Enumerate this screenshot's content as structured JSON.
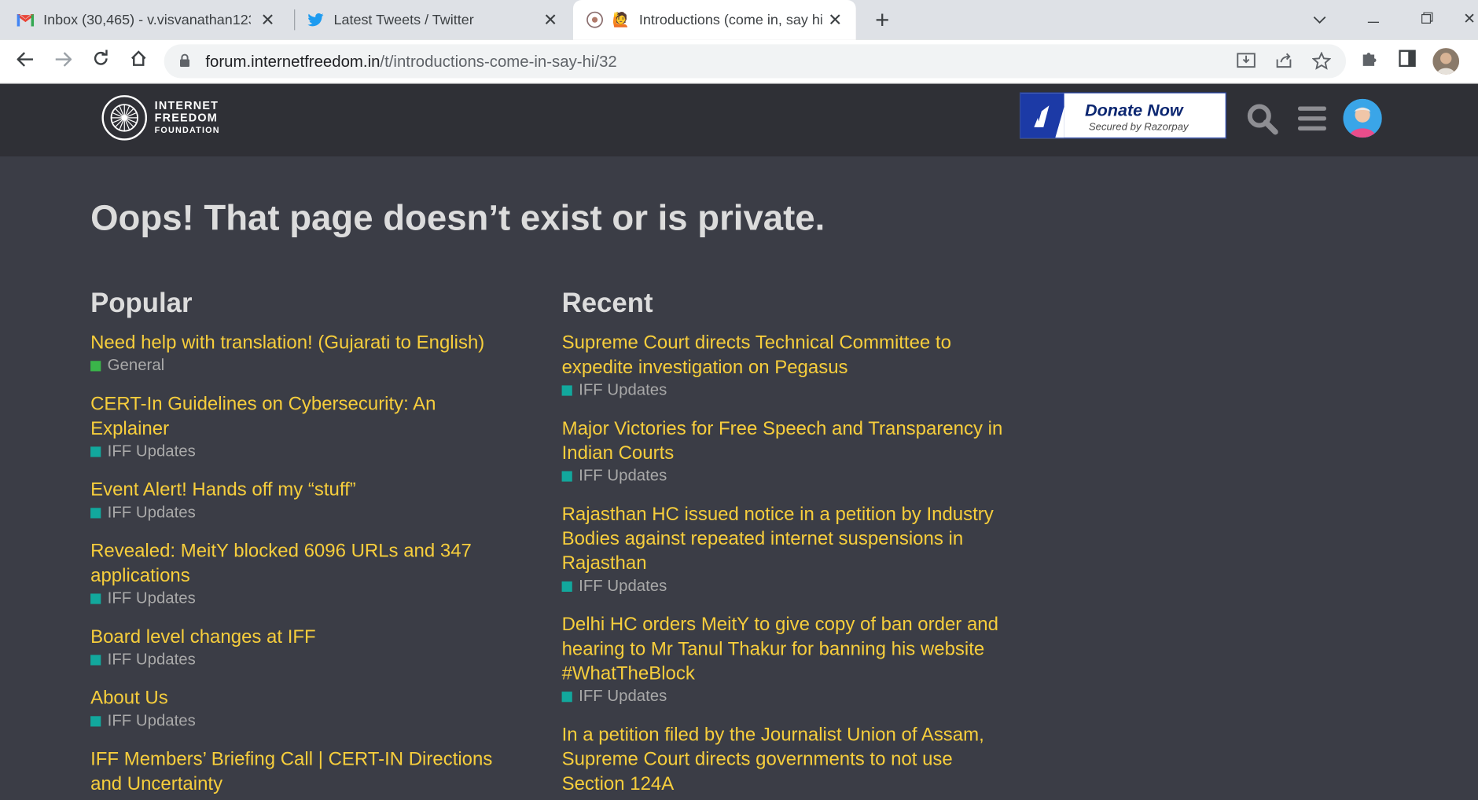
{
  "browser": {
    "tabs": [
      {
        "title": "Inbox (30,465) - v.visvanathan123",
        "icon": "gmail-icon",
        "active": false
      },
      {
        "title": "Latest Tweets / Twitter",
        "icon": "twitter-icon",
        "active": false
      },
      {
        "title": "Introductions (come in, say hi",
        "icon": "site-favicon",
        "active": true
      }
    ],
    "url_domain": "forum.internetfreedom.in",
    "url_path": "/t/introductions-come-in-say-hi/32"
  },
  "site": {
    "logo_line1": "INTERNET",
    "logo_line2": "FREEDOM",
    "logo_line3": "FOUNDATION",
    "donate_label": "Donate Now",
    "donate_sub": "Secured by Razorpay"
  },
  "page": {
    "title": "Oops! That page doesn’t exist or is private."
  },
  "popular": {
    "heading": "Popular",
    "topics": [
      {
        "title": "Need help with translation! (Gujarati to English)",
        "category": "General",
        "color": "#3ab54a"
      },
      {
        "title": "CERT-In Guidelines on Cybersecurity: An Explainer",
        "category": "IFF Updates",
        "color": "#12a89d"
      },
      {
        "title": "Event Alert! Hands off my “stuff”",
        "category": "IFF Updates",
        "color": "#12a89d"
      },
      {
        "title": "Revealed: MeitY blocked 6096 URLs and 347 applications",
        "category": "IFF Updates",
        "color": "#12a89d"
      },
      {
        "title": "Board level changes at IFF",
        "category": "IFF Updates",
        "color": "#12a89d"
      },
      {
        "title": "About Us",
        "category": "IFF Updates",
        "color": "#12a89d"
      },
      {
        "title": "IFF Members’ Briefing Call | CERT-IN Directions and Uncertainty",
        "category": "",
        "color": "#12a89d"
      }
    ]
  },
  "recent": {
    "heading": "Recent",
    "topics": [
      {
        "title": "Supreme Court directs Technical Committee to expedite investigation on Pegasus",
        "category": "IFF Updates",
        "color": "#12a89d"
      },
      {
        "title": "Major Victories for Free Speech and Transparency in Indian Courts",
        "category": "IFF Updates",
        "color": "#12a89d"
      },
      {
        "title": "Rajasthan HC issued notice in a petition by Industry Bodies against repeated internet suspensions in Rajasthan",
        "category": "IFF Updates",
        "color": "#12a89d"
      },
      {
        "title": "Delhi HC orders MeitY to give copy of ban order and hearing to Mr Tanul Thakur for banning his website #WhatTheBlock",
        "category": "IFF Updates",
        "color": "#12a89d"
      },
      {
        "title": "In a petition filed by the Journalist Union of Assam, Supreme Court directs governments to not use Section 124A",
        "category": "",
        "color": "#12a89d"
      }
    ]
  }
}
